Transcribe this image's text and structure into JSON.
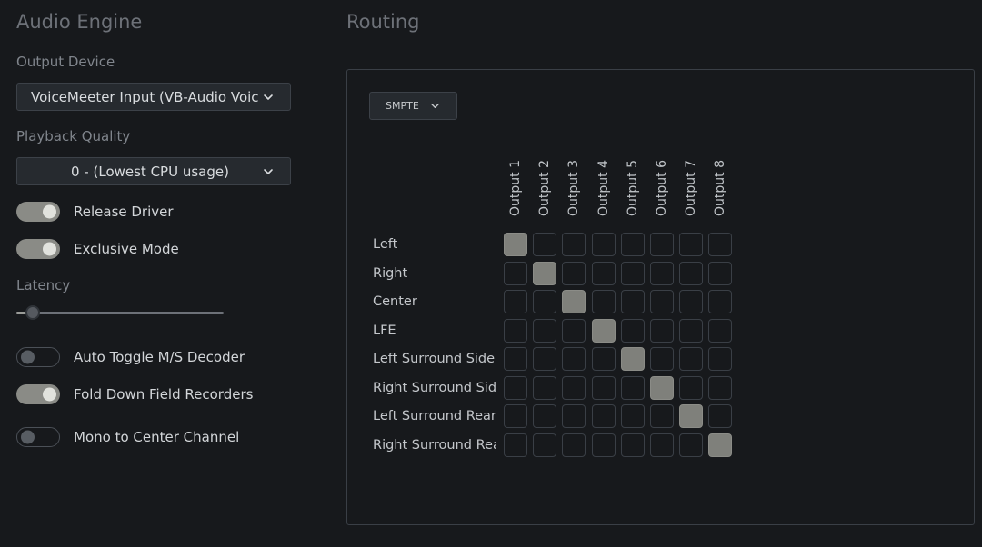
{
  "engine": {
    "title": "Audio Engine",
    "output_device_label": "Output Device",
    "output_device_value": "VoiceMeeter Input (VB-Audio VoiceMeeter VAIO)",
    "playback_quality_label": "Playback Quality",
    "playback_quality_value": "0 - (Lowest CPU usage)",
    "toggles": [
      {
        "label": "Release Driver",
        "on": true
      },
      {
        "label": "Exclusive Mode",
        "on": true
      }
    ],
    "latency_label": "Latency",
    "latency_value": 0.04,
    "toggles2": [
      {
        "label": "Auto Toggle M/S Decoder",
        "on": false
      },
      {
        "label": "Fold Down Field Recorders",
        "on": true
      },
      {
        "label": "Mono to Center Channel",
        "on": false
      }
    ]
  },
  "routing": {
    "title": "Routing",
    "preset": "SMPTE",
    "outputs": [
      "Output 1",
      "Output 2",
      "Output 3",
      "Output 4",
      "Output 5",
      "Output 6",
      "Output 7",
      "Output 8"
    ],
    "channels": [
      "Left",
      "Right",
      "Center",
      "LFE",
      "Left Surround Side",
      "Right Surround Side",
      "Left Surround Rear",
      "Right Surround Rear"
    ],
    "matrix": [
      [
        1,
        0,
        0,
        0,
        0,
        0,
        0,
        0
      ],
      [
        0,
        1,
        0,
        0,
        0,
        0,
        0,
        0
      ],
      [
        0,
        0,
        1,
        0,
        0,
        0,
        0,
        0
      ],
      [
        0,
        0,
        0,
        1,
        0,
        0,
        0,
        0
      ],
      [
        0,
        0,
        0,
        0,
        1,
        0,
        0,
        0
      ],
      [
        0,
        0,
        0,
        0,
        0,
        1,
        0,
        0
      ],
      [
        0,
        0,
        0,
        0,
        0,
        0,
        1,
        0
      ],
      [
        0,
        0,
        0,
        0,
        0,
        0,
        0,
        1
      ]
    ]
  },
  "colors": {
    "background": "#17191c",
    "toggle_on": "#8a8b86",
    "cell_on": "#7f807b"
  },
  "icons": {
    "dropdown": "chevron-down-icon"
  }
}
